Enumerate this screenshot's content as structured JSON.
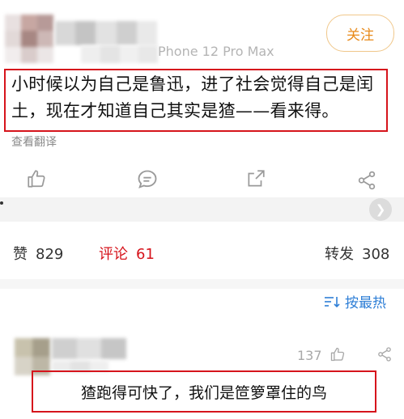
{
  "post": {
    "follow_label": "关注",
    "device": "Phone 12 Pro Max",
    "text": "小时候以为自己是鲁迅，进了社会觉得自己是闰土，现在才知道自己其实是猹——看来得。",
    "translate_label": "查看翻译"
  },
  "actions": {
    "like_icon": "thumbs-up-icon",
    "comment_icon": "comment-bubble-icon",
    "share_icon": "share-out-icon",
    "more_icon": "share-nodes-icon"
  },
  "stats": {
    "likes_label": "赞",
    "likes_count": "829",
    "comments_label": "评论",
    "comments_count": "61",
    "reposts_label": "转发",
    "reposts_count": "308"
  },
  "comments": {
    "sort_label": "按最热",
    "items": [
      {
        "like_count": "137",
        "text": "猹跑得可快了，我们是笸箩罩住的鸟"
      }
    ]
  },
  "colors": {
    "highlight_red": "#d6141c",
    "follow_orange": "#e88a1a",
    "link_blue": "#2f7fd6"
  }
}
